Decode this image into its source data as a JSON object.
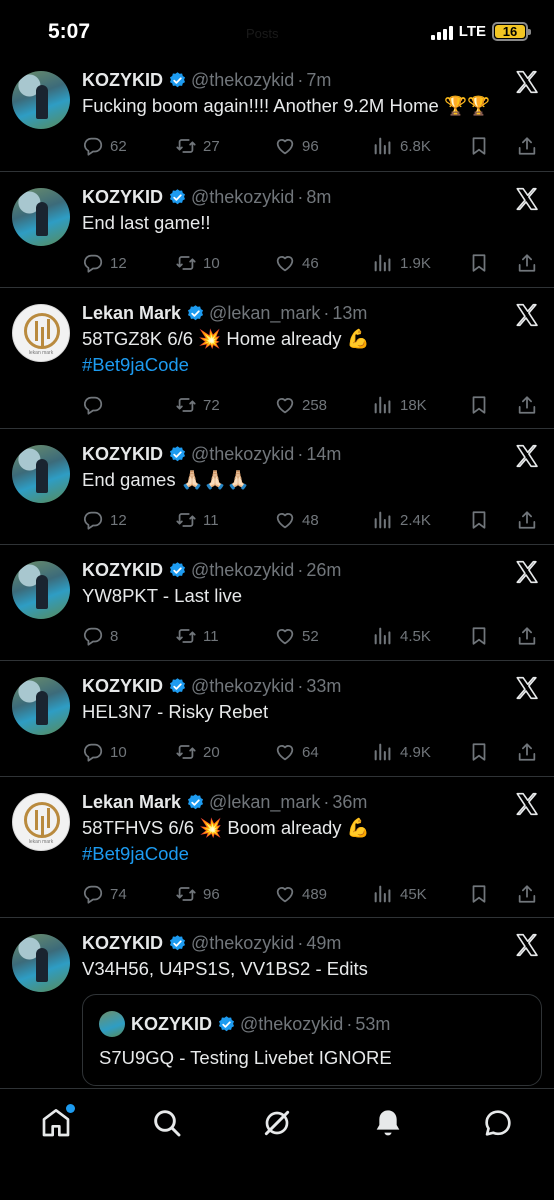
{
  "status": {
    "time": "5:07",
    "network": "LTE",
    "battery": "16",
    "ghost_title": "Posts"
  },
  "tweets": [
    {
      "name": "KOZYKID",
      "handle": "@thekozykid",
      "time": "7m",
      "text": "Fucking boom again!!!! Another 9.2M Home 🏆🏆",
      "hashtag": "",
      "replies": "62",
      "retweets": "27",
      "likes": "96",
      "views": "6.8K",
      "avatar": "kozy"
    },
    {
      "name": "KOZYKID",
      "handle": "@thekozykid",
      "time": "8m",
      "text": "End last game!!",
      "hashtag": "",
      "replies": "12",
      "retweets": "10",
      "likes": "46",
      "views": "1.9K",
      "avatar": "kozy"
    },
    {
      "name": "Lekan Mark",
      "handle": "@lekan_mark",
      "time": "13m",
      "text": "58TGZ8K  6/6 💥  Home already 💪",
      "hashtag": "#Bet9jaCode",
      "replies": "",
      "retweets": "72",
      "likes": "258",
      "views": "18K",
      "avatar": "lekan"
    },
    {
      "name": "KOZYKID",
      "handle": "@thekozykid",
      "time": "14m",
      "text": "End games 🙏🏻🙏🏻🙏🏻",
      "hashtag": "",
      "replies": "12",
      "retweets": "11",
      "likes": "48",
      "views": "2.4K",
      "avatar": "kozy"
    },
    {
      "name": "KOZYKID",
      "handle": "@thekozykid",
      "time": "26m",
      "text": "YW8PKT - Last live",
      "hashtag": "",
      "replies": "8",
      "retweets": "11",
      "likes": "52",
      "views": "4.5K",
      "avatar": "kozy"
    },
    {
      "name": "KOZYKID",
      "handle": "@thekozykid",
      "time": "33m",
      "text": "HEL3N7 - Risky Rebet",
      "hashtag": "",
      "replies": "10",
      "retweets": "20",
      "likes": "64",
      "views": "4.9K",
      "avatar": "kozy"
    },
    {
      "name": "Lekan Mark",
      "handle": "@lekan_mark",
      "time": "36m",
      "text": "58TFHVS   6/6 💥 Boom already 💪",
      "hashtag": "#Bet9jaCode",
      "replies": "74",
      "retweets": "96",
      "likes": "489",
      "views": "45K",
      "avatar": "lekan"
    },
    {
      "name": "KOZYKID",
      "handle": "@thekozykid",
      "time": "49m",
      "text": "V34H56, U4PS1S, VV1BS2 - Edits",
      "hashtag": "",
      "avatar": "kozy",
      "quote": {
        "name": "KOZYKID",
        "handle": "@thekozykid",
        "time": "53m",
        "text": "S7U9GQ - Testing Livebet IGNORE"
      }
    }
  ],
  "lekan_avatar_caption": "lekan mark",
  "colors": {
    "accent": "#1d9bf0",
    "muted": "#71767b",
    "divider": "#2f3336",
    "battery": "#f3c623"
  },
  "nav": [
    "home-icon",
    "search-icon",
    "grok-icon",
    "notifications-icon",
    "messages-icon"
  ]
}
